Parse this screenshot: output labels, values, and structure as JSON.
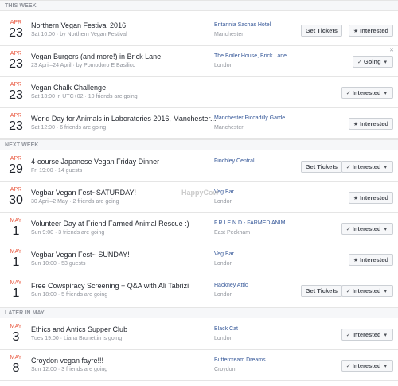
{
  "watermark": "HappyCow",
  "sections": [
    {
      "label": "THIS WEEK"
    },
    {
      "label": "NEXT WEEK"
    },
    {
      "label": "LATER IN MAY"
    }
  ],
  "events": [
    {
      "month": "APR",
      "day": "23",
      "title": "Northern Vegan Festival 2016",
      "subtitle": "Sat 10:00 · by Northern Vegan Festival",
      "venue": "Britannia Sachas Hotel",
      "city": "Manchester",
      "tickets": "Get Tickets",
      "rsvp": "Interested",
      "rsvp_icon": "★"
    },
    {
      "month": "APR",
      "day": "23",
      "title": "Vegan Burgers (and more!) in Brick Lane",
      "subtitle": "23 April–24 April · by Pomodoro E Basilico",
      "venue": "The Boiler House, Brick Lane",
      "city": "London",
      "tickets": "",
      "rsvp": "Going",
      "rsvp_icon": "✓",
      "close": "✕"
    },
    {
      "month": "APR",
      "day": "23",
      "title": "Vegan Chalk Challenge",
      "subtitle": "Sat 13:00 in UTC+02 · 10 friends are going",
      "venue": "",
      "city": "",
      "tickets": "",
      "rsvp": "Interested",
      "rsvp_icon": "✓"
    },
    {
      "month": "APR",
      "day": "23",
      "title": "World Day for Animals in Laboratories 2016, Manchester...",
      "subtitle": "Sat 12:00 · 6 friends are going",
      "venue": "Manchester Piccadilly Garde...",
      "city": "Manchester",
      "tickets": "",
      "rsvp": "Interested",
      "rsvp_icon": "★"
    },
    {
      "month": "APR",
      "day": "29",
      "title": "4-course Japanese Vegan Friday Dinner",
      "subtitle": "Fri 19:00 · 14 guests",
      "venue": "Finchley Central",
      "city": "",
      "tickets": "Get Tickets",
      "rsvp": "Interested",
      "rsvp_icon": "✓"
    },
    {
      "month": "APR",
      "day": "30",
      "title": "Vegbar Vegan Fest~SATURDAY!",
      "subtitle": "30 April–2 May · 2 friends are going",
      "venue": "Veg Bar",
      "city": "London",
      "tickets": "",
      "rsvp": "Interested",
      "rsvp_icon": "★"
    },
    {
      "month": "MAY",
      "day": "1",
      "title": "Volunteer Day at Friend Farmed Animal Rescue :)",
      "subtitle": "Sun 9:00 · 3 friends are going",
      "venue": "F.R.I.E.N.D - FARMED ANIM...",
      "city": "East Peckham",
      "tickets": "",
      "rsvp": "Interested",
      "rsvp_icon": "✓"
    },
    {
      "month": "MAY",
      "day": "1",
      "title": "Vegbar Vegan Fest~ SUNDAY!",
      "subtitle": "Sun 10:00 · 53 guests",
      "venue": "Veg Bar",
      "city": "London",
      "tickets": "",
      "rsvp": "Interested",
      "rsvp_icon": "★"
    },
    {
      "month": "MAY",
      "day": "1",
      "title": "Free Cowspiracy Screening + Q&A with Ali Tabrizi",
      "subtitle": "Sun 18:00 · 5 friends are going",
      "venue": "Hackney Attic",
      "city": "London",
      "tickets": "Get Tickets",
      "rsvp": "Interested",
      "rsvp_icon": "✓"
    },
    {
      "month": "MAY",
      "day": "3",
      "title": "Ethics and Antics Supper Club",
      "subtitle": "Tues 19:00 · Liana Brunettin is going",
      "venue": "Black Cat",
      "city": "London",
      "tickets": "",
      "rsvp": "Interested",
      "rsvp_icon": "✓"
    },
    {
      "month": "MAY",
      "day": "8",
      "title": "Croydon vegan fayre!!!",
      "subtitle": "Sun 12:00 · 3 friends are going",
      "venue": "Buttercream Dreams",
      "city": "Croydon",
      "tickets": "",
      "rsvp": "Interested",
      "rsvp_icon": "✓"
    }
  ]
}
